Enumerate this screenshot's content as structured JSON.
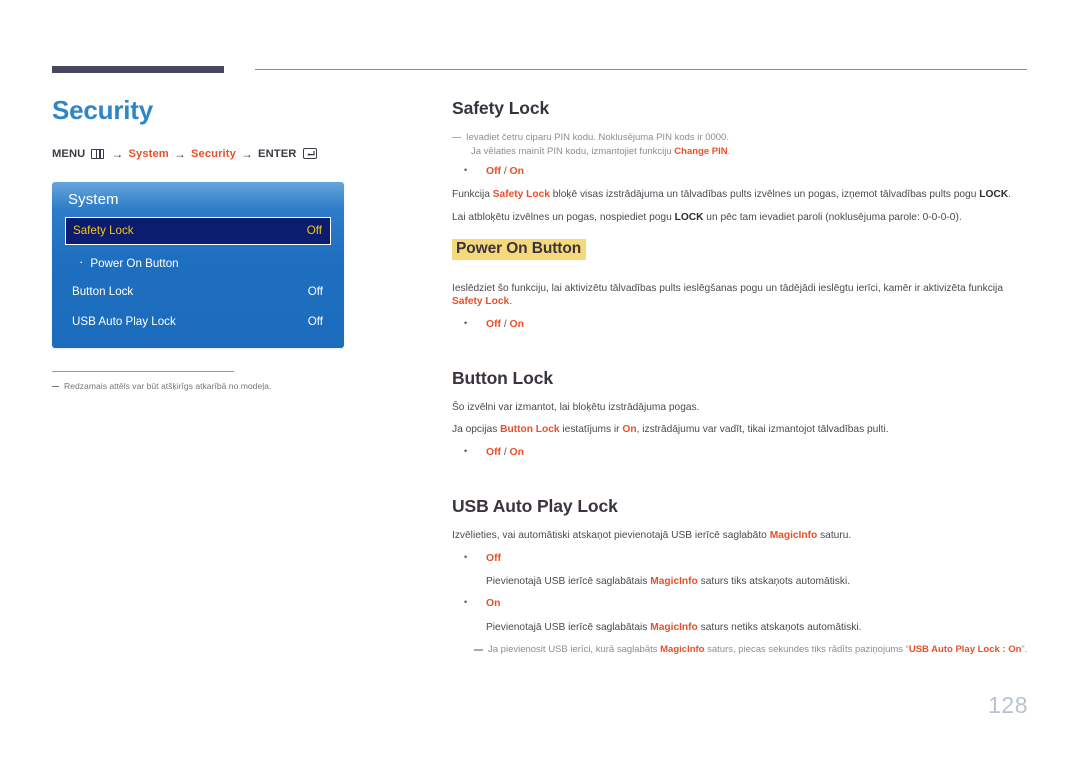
{
  "page": {
    "number": "128"
  },
  "left": {
    "title": "Security",
    "breadcrumb": {
      "menu_label": "MENU",
      "menu_icon": "menu-grid-icon",
      "arrow": "→",
      "crumb1": "System",
      "crumb2": "Security",
      "enter_label": "ENTER",
      "enter_icon": "enter-key-icon"
    },
    "osd": {
      "title": "System",
      "rows": [
        {
          "label": "Safety Lock",
          "value": "Off",
          "selected": true,
          "sub": false
        },
        {
          "label": "Power On Button",
          "value": "",
          "selected": false,
          "sub": true
        },
        {
          "label": "Button Lock",
          "value": "Off",
          "selected": false,
          "sub": false
        },
        {
          "label": "USB Auto Play Lock",
          "value": "Off",
          "selected": false,
          "sub": false
        }
      ]
    },
    "note": "Redzamais attēls var būt atšķirīgs atkarībā no modeļa."
  },
  "sections": {
    "safety_lock": {
      "heading": "Safety Lock",
      "note_line1": "Ievadiet četru ciparu PIN kodu. Noklusējuma PIN kods ir 0000.",
      "note_line2_pre": "Ja vēlaties mainīt PIN kodu, izmantojiet funkciju ",
      "note_line2_bold": "Change PIN",
      "note_line2_post": ".",
      "option_off": "Off",
      "option_sep": " / ",
      "option_on": "On",
      "p1_a": "Funkcija ",
      "p1_b": "Safety Lock",
      "p1_c": " bloķē visas izstrādājuma un tālvadības pults izvēlnes un pogas, izņemot tālvadības pults pogu ",
      "p1_d": "LOCK",
      "p1_e": ".",
      "p2_a": "Lai atbloķētu izvēlnes un pogas, nospiediet pogu ",
      "p2_b": "LOCK",
      "p2_c": " un pēc tam ievadiet paroli (noklusējuma parole: 0-0-0-0)."
    },
    "power_on_button": {
      "heading": "Power On Button",
      "p1_a": "Ieslēdziet šo funkciju, lai aktivizētu tālvadības pults ieslēgšanas pogu un tādējādi ieslēgtu ierīci, kamēr ir aktivizēta funkcija ",
      "p1_b": "Safety Lock",
      "p1_c": ".",
      "option_off": "Off",
      "option_sep": " / ",
      "option_on": "On"
    },
    "button_lock": {
      "heading": "Button Lock",
      "p1": "Šo izvēlni var izmantot, lai bloķētu izstrādājuma pogas.",
      "p2_a": "Ja opcijas ",
      "p2_b": "Button Lock",
      "p2_c": " iestatījums ir ",
      "p2_d": "On",
      "p2_e": ", izstrādājumu var vadīt, tikai izmantojot tālvadības pulti.",
      "option_off": "Off",
      "option_sep": " / ",
      "option_on": "On"
    },
    "usb_auto_play_lock": {
      "heading": "USB Auto Play Lock",
      "p1_a": "Izvēlieties, vai automātiski atskaņot pievienotajā USB ierīcē saglabāto ",
      "p1_b": "MagicInfo",
      "p1_c": " saturu.",
      "opt_off_label": "Off",
      "opt_off_desc_a": "Pievienotajā USB ierīcē saglabātais ",
      "opt_off_desc_b": "MagicInfo",
      "opt_off_desc_c": " saturs tiks atskaņots automātiski.",
      "opt_on_label": "On",
      "opt_on_desc_a": "Pievienotajā USB ierīcē saglabātais ",
      "opt_on_desc_b": "MagicInfo",
      "opt_on_desc_c": " saturs netiks atskaņots automātiski.",
      "note_a": "Ja pievienosit USB ierīci, kurā saglabāts ",
      "note_b": "MagicInfo",
      "note_c": " saturs, piecas sekundes tiks rādīts paziņojums “",
      "note_d": "USB Auto Play Lock : On",
      "note_e": "”."
    }
  },
  "colors": {
    "accent_orange": "#e8502a",
    "title_blue": "#2e86c8",
    "osd_blue": "#1f6fc0",
    "osd_selected_bg": "#0b1d6e",
    "osd_selected_text": "#f5c518",
    "highlight_yellow": "#f6d97a",
    "page_number": "#b9c2d2"
  }
}
